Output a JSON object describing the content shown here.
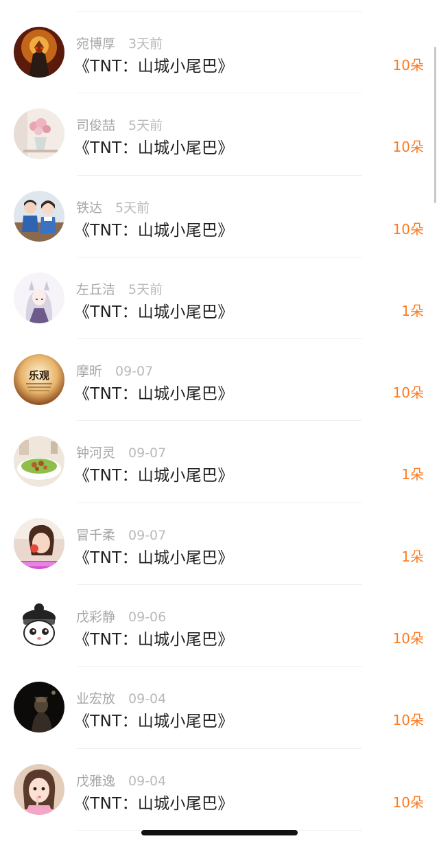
{
  "records": [
    {
      "name": "宛博厚",
      "time": "3天前",
      "title": "《TNT：山城小尾巴》",
      "amount": "10朵",
      "avatar": "armored-hero-avatar"
    },
    {
      "name": "司俊喆",
      "time": "5天前",
      "title": "《TNT：山城小尾巴》",
      "amount": "10朵",
      "avatar": "flower-vase-avatar"
    },
    {
      "name": "铁达",
      "time": "5天前",
      "title": "《TNT：山城小尾巴》",
      "amount": "10朵",
      "avatar": "students-avatar"
    },
    {
      "name": "左丘洁",
      "time": "5天前",
      "title": "《TNT：山城小尾巴》",
      "amount": "1朵",
      "avatar": "anime-fox-girl-avatar"
    },
    {
      "name": "摩昕",
      "time": "09-07",
      "title": "《TNT：山城小尾巴》",
      "amount": "10朵",
      "avatar": "leguan-text-avatar",
      "avatar_text": "乐观"
    },
    {
      "name": "钟河灵",
      "time": "09-07",
      "title": "《TNT：山城小尾巴》",
      "amount": "1朵",
      "avatar": "food-dish-avatar"
    },
    {
      "name": "冒千柔",
      "time": "09-07",
      "title": "《TNT：山城小尾巴》",
      "amount": "1朵",
      "avatar": "girl-selfie-avatar"
    },
    {
      "name": "戊彩静",
      "time": "09-06",
      "title": "《TNT：山城小尾巴》",
      "amount": "10朵",
      "avatar": "cartoon-bun-avatar"
    },
    {
      "name": "业宏放",
      "time": "09-04",
      "title": "《TNT：山城小尾巴》",
      "amount": "10朵",
      "avatar": "dark-figure-avatar"
    },
    {
      "name": "戊雅逸",
      "time": "09-04",
      "title": "《TNT：山城小尾巴》",
      "amount": "10朵",
      "avatar": "girl-portrait-avatar"
    }
  ],
  "colors": {
    "accent": "#ff7a1f",
    "name_text": "#a6a6a6",
    "title_text": "#1f1f1f"
  }
}
